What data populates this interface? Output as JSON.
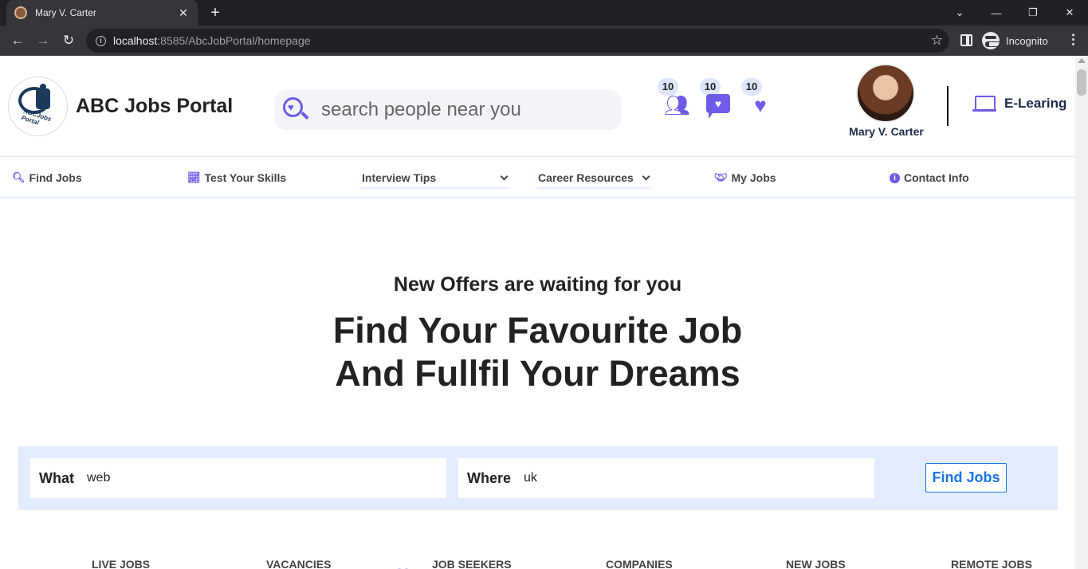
{
  "browser": {
    "tab_title": "Mary V. Carter",
    "url_host": "localhost",
    "url_rest": ":8585/AbcJobPortal/homepage",
    "profile_label": "Incognito"
  },
  "header": {
    "brand": "ABC Jobs Portal",
    "logo_text": "ABCJobs Portal",
    "search_placeholder": "search people near you",
    "notifications": [
      {
        "name": "friends",
        "count": "10"
      },
      {
        "name": "messages",
        "count": "10"
      },
      {
        "name": "likes",
        "count": "10"
      }
    ],
    "user_name": "Mary V. Carter",
    "elearning_label": "E-Learing"
  },
  "nav": {
    "find_jobs": "Find Jobs",
    "test_skills": "Test Your Skills",
    "interview_tips": "Interview Tips",
    "career_resources": "Career Resources",
    "my_jobs": "My Jobs",
    "contact_info": "Contact Info"
  },
  "hero": {
    "subtitle": "New Offers are waiting for you",
    "title_line1": "Find Your Favourite Job",
    "title_line2": "And Fullfil Your Dreams"
  },
  "job_search": {
    "what_label": "What",
    "what_value": "web",
    "where_label": "Where",
    "where_value": "uk",
    "button": "Find Jobs"
  },
  "stats": [
    "LIVE JOBS",
    "VACANCIES",
    "JOB SEEKERS",
    "COMPANIES",
    "NEW JOBS",
    "REMOTE JOBS"
  ],
  "colors": {
    "accent": "#6c5ce7",
    "link_blue": "#1a73e8",
    "search_band": "#e3ecfc"
  }
}
